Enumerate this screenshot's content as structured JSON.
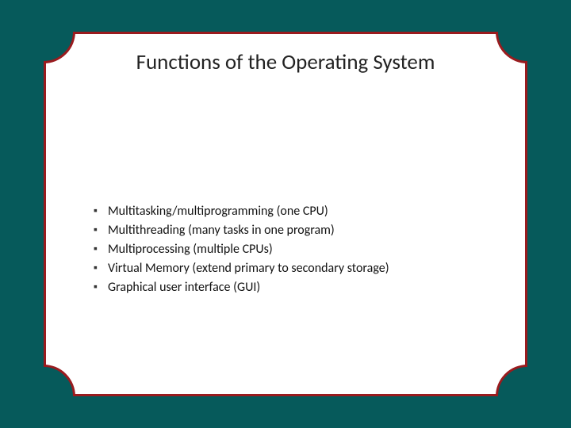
{
  "slide": {
    "title": "Functions of the Operating System",
    "bullets": [
      "Multitasking/multiprogramming (one CPU)",
      "Multithreading (many tasks in one program)",
      "Multiprocessing (multiple CPUs)",
      "Virtual Memory (extend primary to secondary storage)",
      "Graphical user interface (GUI)"
    ]
  }
}
